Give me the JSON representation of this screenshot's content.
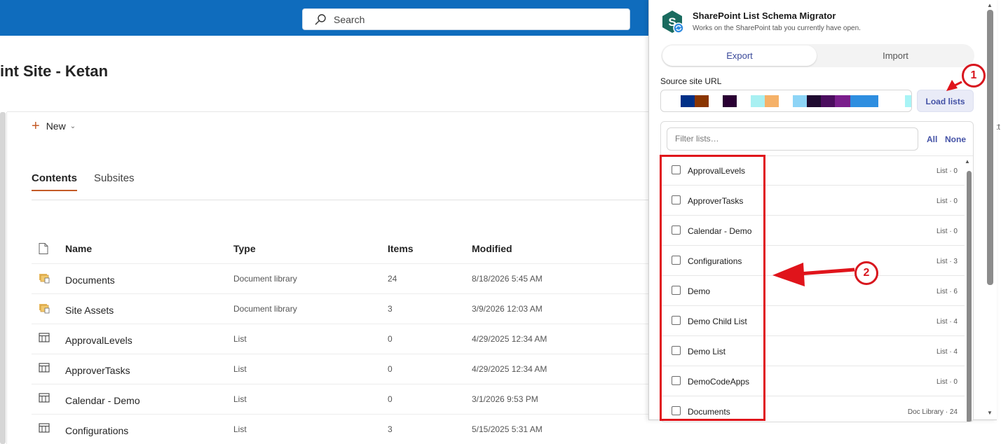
{
  "sharepoint": {
    "search_placeholder": "Search",
    "site_title": "int Site - Ketan",
    "new_label": "New",
    "tabs": [
      {
        "label": "Contents",
        "active": true
      },
      {
        "label": "Subsites",
        "active": false
      }
    ],
    "columns": {
      "name": "Name",
      "type": "Type",
      "items": "Items",
      "modified": "Modified"
    },
    "rows": [
      {
        "icon": "document-library-icon",
        "name": "Documents",
        "type": "Document library",
        "items": "24",
        "modified": "8/18/2026 5:45 AM"
      },
      {
        "icon": "document-library-icon",
        "name": "Site Assets",
        "type": "Document library",
        "items": "3",
        "modified": "3/9/2026 12:03 AM"
      },
      {
        "icon": "list-icon",
        "name": "ApprovalLevels",
        "type": "List",
        "items": "0",
        "modified": "4/29/2025 12:34 AM"
      },
      {
        "icon": "list-icon",
        "name": "ApproverTasks",
        "type": "List",
        "items": "0",
        "modified": "4/29/2025 12:34 AM"
      },
      {
        "icon": "list-icon",
        "name": "Calendar - Demo",
        "type": "List",
        "items": "0",
        "modified": "3/1/2026 9:53 PM"
      },
      {
        "icon": "list-icon",
        "name": "Configurations",
        "type": "List",
        "items": "3",
        "modified": "5/15/2025 5:31 AM"
      }
    ],
    "edge_text": "tt",
    "accent_color": "#0f6cbd"
  },
  "extension": {
    "title": "SharePoint List Schema Migrator",
    "subtitle": "Works on the SharePoint tab you currently have open.",
    "tab_export": "Export",
    "tab_import": "Import",
    "source_label": "Source site URL",
    "load_button": "Load lists",
    "filter_placeholder": "Filter lists…",
    "select_all": "All",
    "select_none": "None",
    "lists": [
      {
        "name": "ApprovalLevels",
        "meta": "List · 0"
      },
      {
        "name": "ApproverTasks",
        "meta": "List · 0"
      },
      {
        "name": "Calendar - Demo",
        "meta": "List · 0"
      },
      {
        "name": "Configurations",
        "meta": "List · 3"
      },
      {
        "name": "Demo",
        "meta": "List · 6"
      },
      {
        "name": "Demo Child List",
        "meta": "List · 4"
      },
      {
        "name": "Demo List",
        "meta": "List · 4"
      },
      {
        "name": "DemoCodeApps",
        "meta": "List · 0"
      },
      {
        "name": "Documents",
        "meta": "Doc Library · 24"
      }
    ],
    "redacted_colors": [
      "#003087",
      "#8a3500",
      "#2a0033",
      "#a8f0f2",
      "#f5b168",
      "#8dd4f6",
      "#1f0a30",
      "#4b0d5e",
      "#7a1e8c",
      "#2e8ee0",
      "#a8f4f6"
    ]
  },
  "annotations": {
    "badge_1": "1",
    "badge_2": "2",
    "color": "#e0141b"
  }
}
